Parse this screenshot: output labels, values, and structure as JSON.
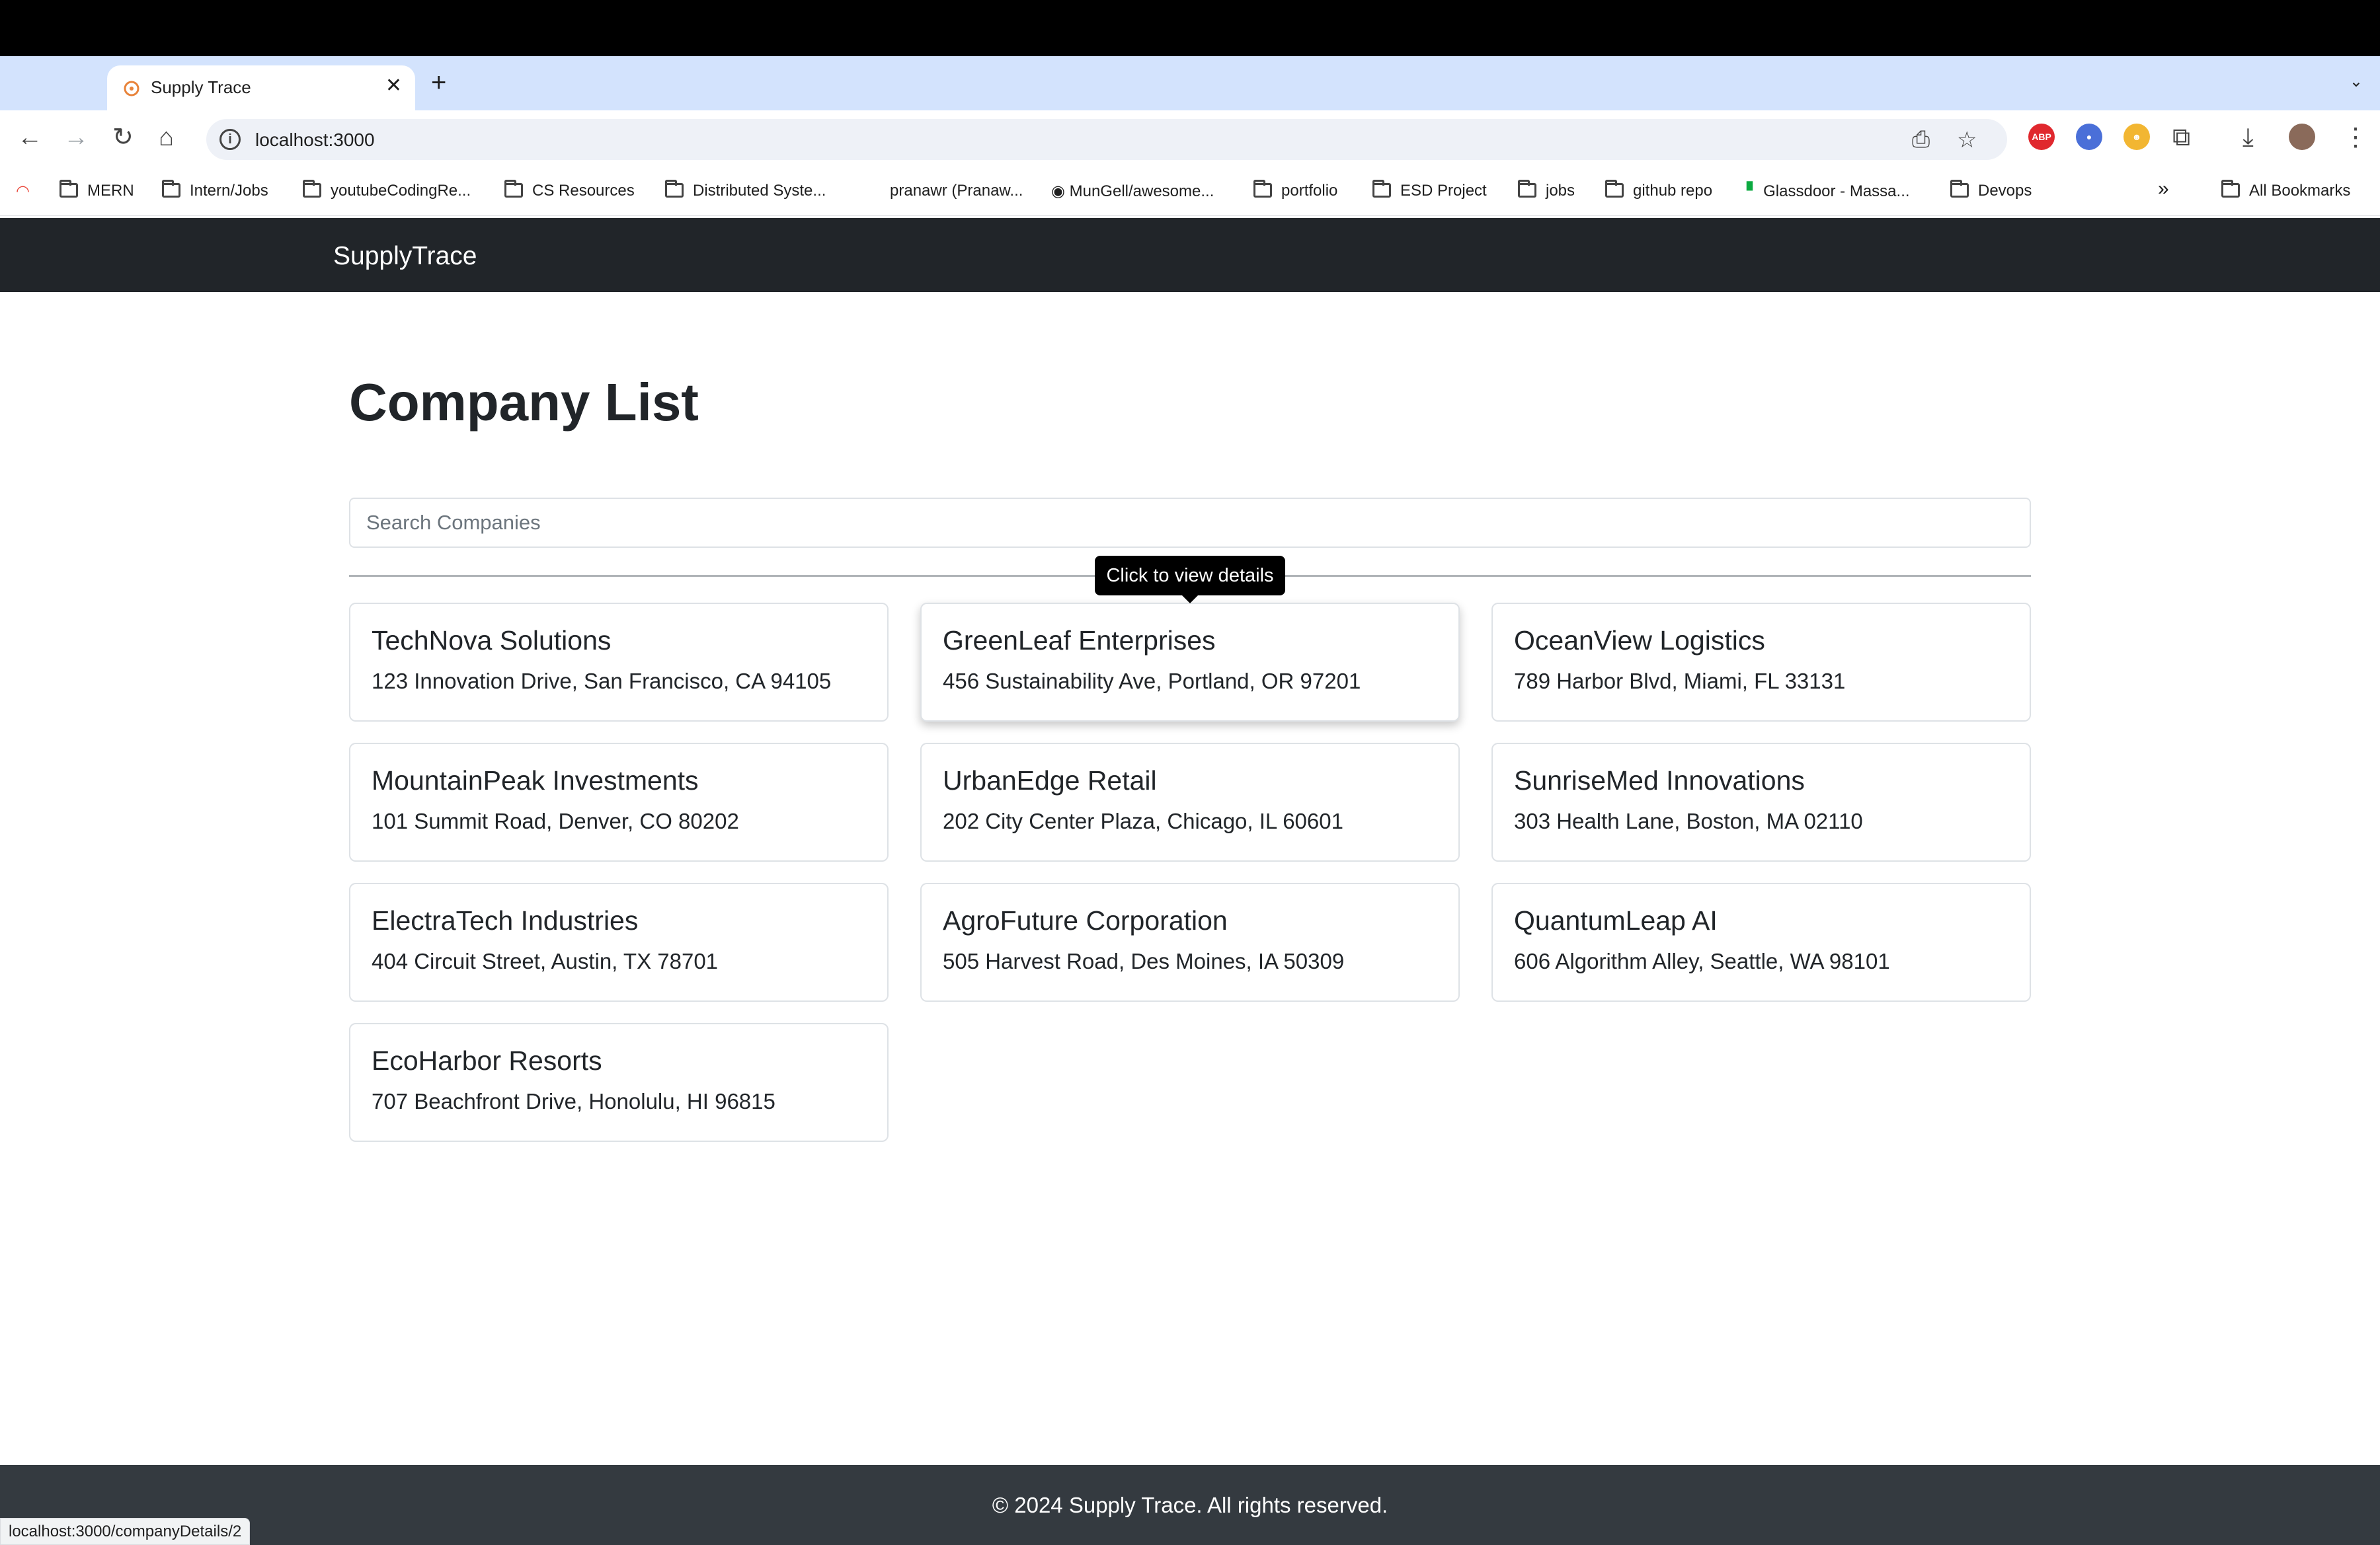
{
  "browser": {
    "tab_title": "Supply Trace",
    "new_tab_label": "+",
    "url": "localhost:3000",
    "status_url": "localhost:3000/companyDetails/2",
    "bookmarks": [
      {
        "label": "MERN"
      },
      {
        "label": "Intern/Jobs"
      },
      {
        "label": "youtubeCodingRe..."
      },
      {
        "label": "CS Resources"
      },
      {
        "label": "Distributed Syste..."
      },
      {
        "label": "pranawr (Pranaw..."
      },
      {
        "label": "MunGell/awesome..."
      },
      {
        "label": "portfolio"
      },
      {
        "label": "ESD Project"
      },
      {
        "label": "jobs"
      },
      {
        "label": "github repo"
      },
      {
        "label": "Glassdoor - Massa..."
      },
      {
        "label": "Devops"
      }
    ],
    "all_bookmarks": "All Bookmarks",
    "extension_abp": "ABP"
  },
  "app": {
    "brand": "SupplyTrace",
    "title": "Company List",
    "search_placeholder": "Search Companies",
    "tooltip": "Click to view details",
    "companies": [
      {
        "name": "TechNova Solutions",
        "address": "123 Innovation Drive, San Francisco, CA 94105"
      },
      {
        "name": "GreenLeaf Enterprises",
        "address": "456 Sustainability Ave, Portland, OR 97201"
      },
      {
        "name": "OceanView Logistics",
        "address": "789 Harbor Blvd, Miami, FL 33131"
      },
      {
        "name": "MountainPeak Investments",
        "address": "101 Summit Road, Denver, CO 80202"
      },
      {
        "name": "UrbanEdge Retail",
        "address": "202 City Center Plaza, Chicago, IL 60601"
      },
      {
        "name": "SunriseMed Innovations",
        "address": "303 Health Lane, Boston, MA 02110"
      },
      {
        "name": "ElectraTech Industries",
        "address": "404 Circuit Street, Austin, TX 78701"
      },
      {
        "name": "AgroFuture Corporation",
        "address": "505 Harvest Road, Des Moines, IA 50309"
      },
      {
        "name": "QuantumLeap AI",
        "address": "606 Algorithm Alley, Seattle, WA 98101"
      },
      {
        "name": "EcoHarbor Resorts",
        "address": "707 Beachfront Drive, Honolulu, HI 96815"
      }
    ],
    "footer": "© 2024 Supply Trace. All rights reserved."
  }
}
